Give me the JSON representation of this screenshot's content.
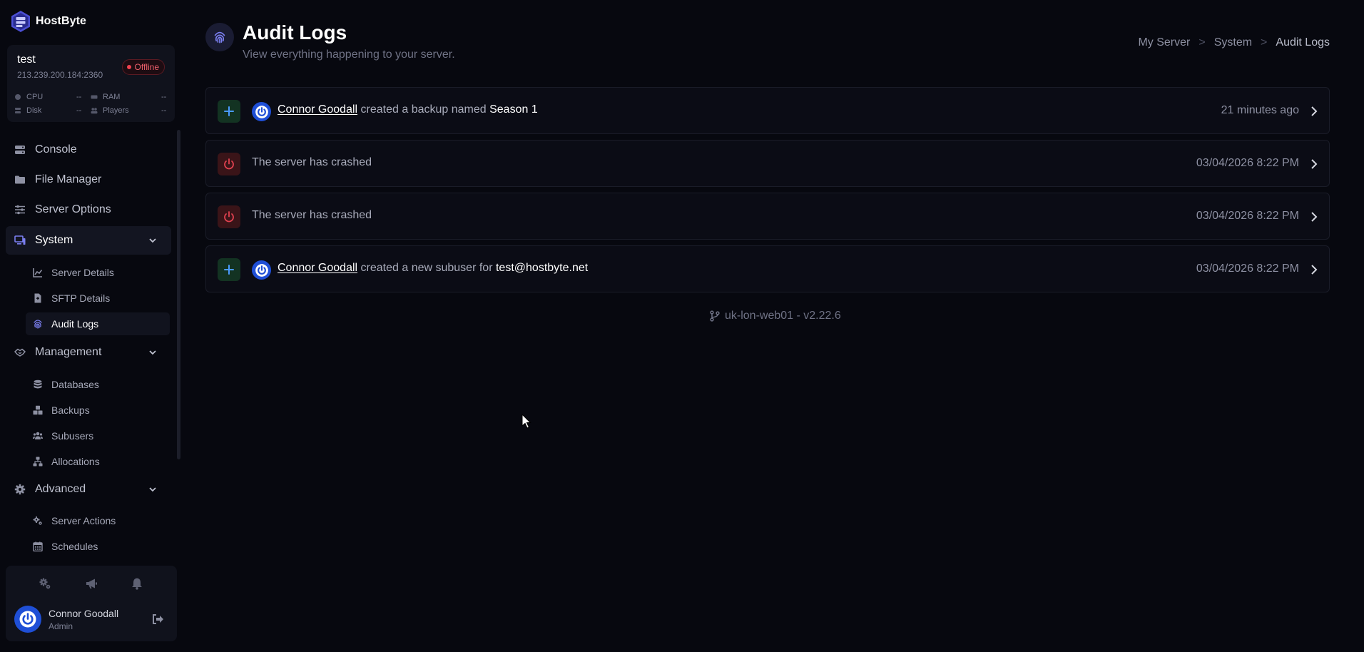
{
  "brand": {
    "name": "HostByte",
    "accent": "#5b5fe0"
  },
  "server": {
    "name": "test",
    "address": "213.239.200.184:2360",
    "status": "Offline",
    "status_color": "#f0414f",
    "stats": [
      {
        "label": "CPU",
        "value": "--",
        "icon": "cpu-icon"
      },
      {
        "label": "RAM",
        "value": "--",
        "icon": "memory-icon"
      },
      {
        "label": "Disk",
        "value": "--",
        "icon": "disk-icon"
      },
      {
        "label": "Players",
        "value": "--",
        "icon": "players-icon"
      }
    ]
  },
  "nav": {
    "console": "Console",
    "file_manager": "File Manager",
    "server_options": "Server Options",
    "system": {
      "label": "System",
      "items": [
        {
          "label": "Server Details",
          "icon": "chart-icon"
        },
        {
          "label": "SFTP Details",
          "icon": "file-icon"
        },
        {
          "label": "Audit Logs",
          "icon": "fingerprint-icon"
        }
      ]
    },
    "management": {
      "label": "Management",
      "items": [
        {
          "label": "Databases",
          "icon": "database-icon"
        },
        {
          "label": "Backups",
          "icon": "boxes-icon"
        },
        {
          "label": "Subusers",
          "icon": "users-icon"
        },
        {
          "label": "Allocations",
          "icon": "network-icon"
        }
      ]
    },
    "advanced": {
      "label": "Advanced",
      "items": [
        {
          "label": "Server Actions",
          "icon": "cogs-icon"
        },
        {
          "label": "Schedules",
          "icon": "calendar-icon"
        }
      ]
    }
  },
  "user": {
    "name": "Connor Goodall",
    "role": "Admin"
  },
  "page": {
    "title": "Audit Logs",
    "subtitle": "View everything happening to your server.",
    "breadcrumb": [
      "My Server",
      "System",
      "Audit Logs"
    ],
    "breadcrumb_separator": ">"
  },
  "logs": [
    {
      "type": "create",
      "actor": "Connor Goodall",
      "action": "created a backup named",
      "subject": "Season 1",
      "time": "21 minutes ago"
    },
    {
      "type": "crash",
      "actor": "",
      "action": "The server has crashed",
      "subject": "",
      "time": "03/04/2026 8:22 PM"
    },
    {
      "type": "crash",
      "actor": "",
      "action": "The server has crashed",
      "subject": "",
      "time": "03/04/2026 8:22 PM"
    },
    {
      "type": "create",
      "actor": "Connor Goodall",
      "action": "created a new subuser for",
      "subject": "test@hostbyte.net",
      "time": "03/04/2026 8:22 PM"
    }
  ],
  "version": "uk-lon-web01 - v2.22.6"
}
